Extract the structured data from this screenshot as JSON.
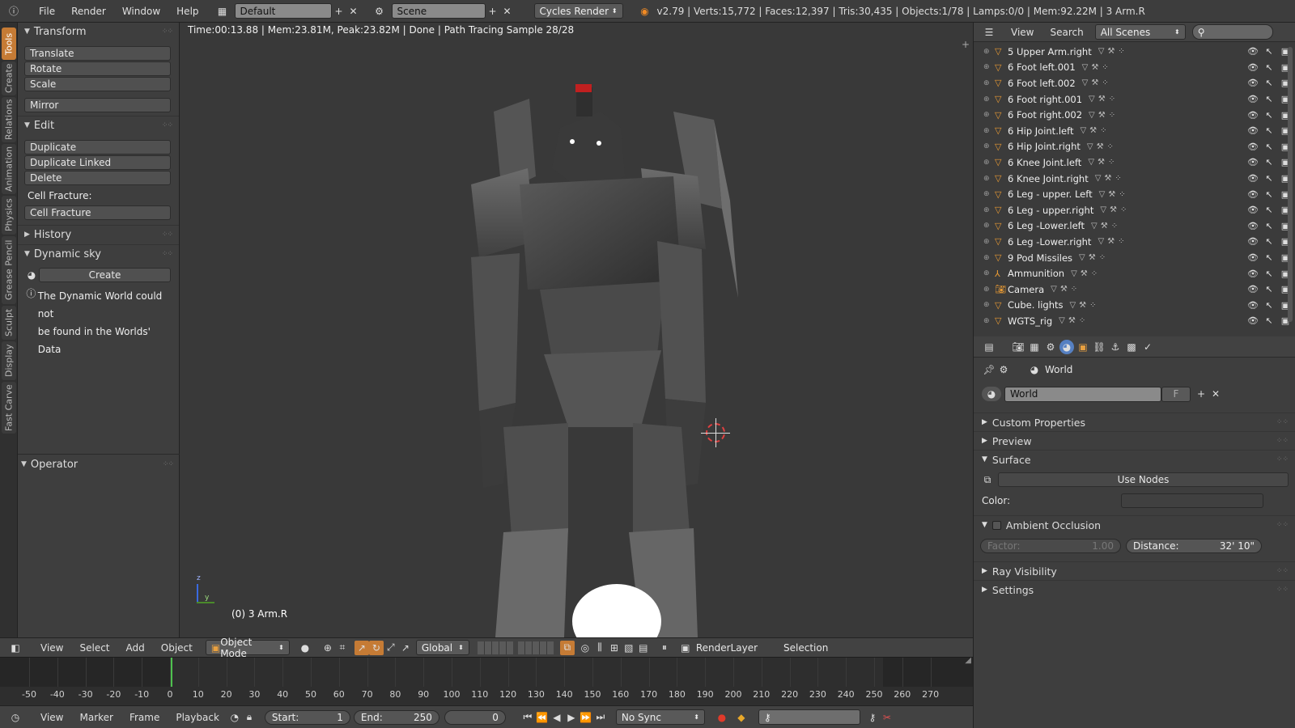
{
  "topbar": {
    "menus": [
      "File",
      "Render",
      "Window",
      "Help"
    ],
    "layout": "Default",
    "scene": "Scene",
    "engine": "Cycles Render",
    "stats": "v2.79 | Verts:15,772 | Faces:12,397 | Tris:30,435 | Objects:1/78 | Lamps:0/0 | Mem:92.22M | 3 Arm.R"
  },
  "tool_tabs": [
    "Tools",
    "Create",
    "Relations",
    "Animation",
    "Physics",
    "Grease Pencil",
    "Sculpt",
    "Display",
    "Fast Carve"
  ],
  "toolshelf": {
    "transform": {
      "title": "Transform",
      "buttons": [
        "Translate",
        "Rotate",
        "Scale",
        "Mirror"
      ]
    },
    "edit": {
      "title": "Edit",
      "buttons": [
        "Duplicate",
        "Duplicate Linked",
        "Delete"
      ],
      "cell_label": "Cell Fracture:",
      "cell_button": "Cell Fracture"
    },
    "history": {
      "title": "History"
    },
    "dynamic_sky": {
      "title": "Dynamic sky",
      "create": "Create",
      "info1": "The Dynamic World could not",
      "info2": "be found in the Worlds' Data"
    },
    "operator": {
      "title": "Operator"
    }
  },
  "viewport": {
    "info": "Time:00:13.88 | Mem:23.81M, Peak:23.82M | Done | Path Tracing Sample 28/28",
    "object_label": "(0) 3 Arm.R",
    "axis_z": "z",
    "axis_y": "y"
  },
  "header3d": {
    "menus": [
      "View",
      "Select",
      "Add",
      "Object"
    ],
    "mode": "Object Mode",
    "orientation": "Global",
    "render_layer": "RenderLayer",
    "selection": "Selection"
  },
  "timeline": {
    "ticks": [
      "-50",
      "-40",
      "-30",
      "-20",
      "-10",
      "0",
      "10",
      "20",
      "30",
      "40",
      "50",
      "60",
      "70",
      "80",
      "90",
      "100",
      "110",
      "120",
      "130",
      "140",
      "150",
      "160",
      "170",
      "180",
      "190",
      "200",
      "210",
      "220",
      "230",
      "240",
      "250",
      "260",
      "270"
    ],
    "menus": [
      "View",
      "Marker",
      "Frame",
      "Playback"
    ],
    "start_label": "Start:",
    "start": "1",
    "end_label": "End:",
    "end": "250",
    "current": "0",
    "sync": "No Sync"
  },
  "outliner": {
    "menus": [
      "View",
      "Search"
    ],
    "filter": "All Scenes",
    "rows": [
      {
        "name": "5 Upper Arm.right",
        "icon": "mesh-icon"
      },
      {
        "name": "6 Foot left.001",
        "icon": "mesh-icon"
      },
      {
        "name": "6 Foot left.002",
        "icon": "mesh-icon"
      },
      {
        "name": "6 Foot right.001",
        "icon": "mesh-icon"
      },
      {
        "name": "6 Foot right.002",
        "icon": "mesh-icon"
      },
      {
        "name": "6 Hip Joint.left",
        "icon": "mesh-icon"
      },
      {
        "name": "6 Hip Joint.right",
        "icon": "mesh-icon"
      },
      {
        "name": "6 Knee Joint.left",
        "icon": "mesh-icon"
      },
      {
        "name": "6 Knee Joint.right",
        "icon": "mesh-icon"
      },
      {
        "name": "6 Leg - upper. Left",
        "icon": "mesh-icon"
      },
      {
        "name": "6 Leg - upper.right",
        "icon": "mesh-icon"
      },
      {
        "name": "6 Leg -Lower.left",
        "icon": "mesh-icon"
      },
      {
        "name": "6 Leg -Lower.right",
        "icon": "mesh-icon"
      },
      {
        "name": "9 Pod Missiles",
        "icon": "mesh-icon"
      },
      {
        "name": "Ammunition",
        "icon": "empty-icon"
      },
      {
        "name": "Camera",
        "icon": "camera-icon"
      },
      {
        "name": "Cube. lights",
        "icon": "mesh-icon"
      },
      {
        "name": "WGTS_rig",
        "icon": "mesh-icon"
      }
    ]
  },
  "properties": {
    "context": "World",
    "world_name": "World",
    "fake_user": "F",
    "sections": {
      "custom": "Custom Properties",
      "preview": "Preview",
      "surface": "Surface",
      "ao": "Ambient Occlusion",
      "ray": "Ray Visibility",
      "settings": "Settings"
    },
    "use_nodes": "Use Nodes",
    "color_label": "Color:",
    "factor_label": "Factor:",
    "factor": "1.00",
    "distance_label": "Distance:",
    "distance": "32' 10\""
  }
}
